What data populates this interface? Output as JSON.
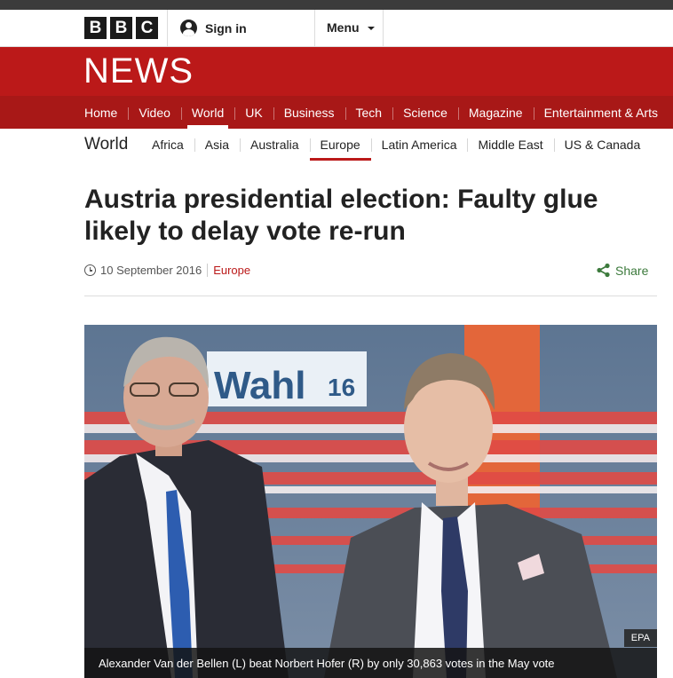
{
  "masthead": {
    "logo_letters": [
      "B",
      "B",
      "C"
    ],
    "signin_label": "Sign in",
    "menu_label": "Menu",
    "icons": {
      "signin": "user-icon",
      "menu": "chevron-down-icon"
    }
  },
  "brand": {
    "section_title": "NEWS"
  },
  "nav": {
    "items": [
      "Home",
      "Video",
      "World",
      "UK",
      "Business",
      "Tech",
      "Science",
      "Magazine",
      "Entertainment & Arts"
    ],
    "active": "World"
  },
  "subnav": {
    "title": "World",
    "items": [
      "Africa",
      "Asia",
      "Australia",
      "Europe",
      "Latin America",
      "Middle East",
      "US & Canada"
    ],
    "active": "Europe"
  },
  "article": {
    "headline": "Austria presidential election: Faulty glue likely to delay vote re-run",
    "date": "10 September 2016",
    "section_link": "Europe",
    "share_label": "Share",
    "image": {
      "sign_text": "Wahl",
      "sign_number": "16",
      "credit": "EPA",
      "caption": "Alexander Van der Bellen (L) beat Norbert Hofer (R) by only 30,863 votes in the May vote"
    }
  },
  "colors": {
    "brand_red": "#bb1919",
    "nav_red": "#a81817",
    "share_green": "#3c7a3c",
    "top_strip": "#3b3b3b"
  }
}
